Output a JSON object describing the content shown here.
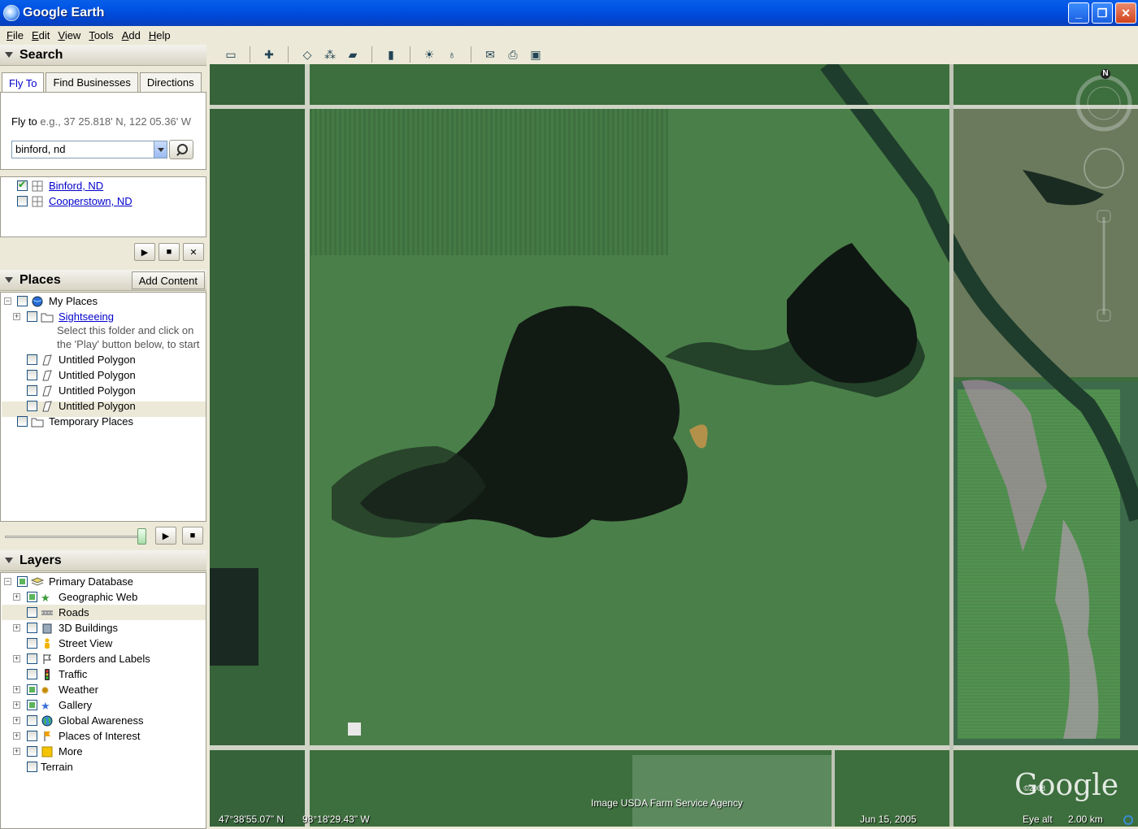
{
  "window": {
    "title": "Google Earth",
    "controls": {
      "minimize": "_",
      "maximize": "❐",
      "close": "✕"
    }
  },
  "menu": [
    "File",
    "Edit",
    "View",
    "Tools",
    "Add",
    "Help"
  ],
  "search": {
    "header": "Search",
    "tabs": [
      "Fly To",
      "Find Businesses",
      "Directions"
    ],
    "flyto_label": "Fly to",
    "flyto_hint": "e.g., 37 25.818' N, 122 05.36' W",
    "input_value": "binford, nd",
    "results": [
      {
        "label": "Binford, ND",
        "checked": true
      },
      {
        "label": "Cooperstown, ND",
        "checked": false
      }
    ]
  },
  "places": {
    "header": "Places",
    "add_content": "Add Content",
    "items": [
      {
        "label": "My Places"
      },
      {
        "label": "Sightseeing"
      },
      {
        "label": "Select this folder and click on"
      },
      {
        "label": "the 'Play' button below, to start"
      },
      {
        "label": "Untitled Polygon"
      },
      {
        "label": "Untitled Polygon"
      },
      {
        "label": "Untitled Polygon"
      },
      {
        "label": "Untitled Polygon"
      },
      {
        "label": "Temporary Places"
      }
    ]
  },
  "layers": {
    "header": "Layers",
    "items": [
      {
        "label": "Primary Database"
      },
      {
        "label": "Geographic Web"
      },
      {
        "label": "Roads"
      },
      {
        "label": "3D Buildings"
      },
      {
        "label": "Street View"
      },
      {
        "label": "Borders and Labels"
      },
      {
        "label": "Traffic"
      },
      {
        "label": "Weather"
      },
      {
        "label": "Gallery"
      },
      {
        "label": "Global Awareness"
      },
      {
        "label": "Places of Interest"
      },
      {
        "label": "More"
      },
      {
        "label": "Terrain"
      }
    ]
  },
  "map": {
    "north_label": "N",
    "latitude": "47°38'55.07\" N",
    "longitude": "98°18'29.43\" W",
    "imagery_credit": "Image USDA Farm Service Agency",
    "imagery_date": "Jun 15, 2005",
    "eye_alt_label": "Eye alt",
    "eye_alt_value": "2.00 km",
    "logo": "Google",
    "copyright": "©2008"
  },
  "colors": {
    "titlebar": "#0055e5",
    "panel": "#ece9d8",
    "link": "#0000cc",
    "water": "#101812",
    "field": "#3b6b3a"
  }
}
